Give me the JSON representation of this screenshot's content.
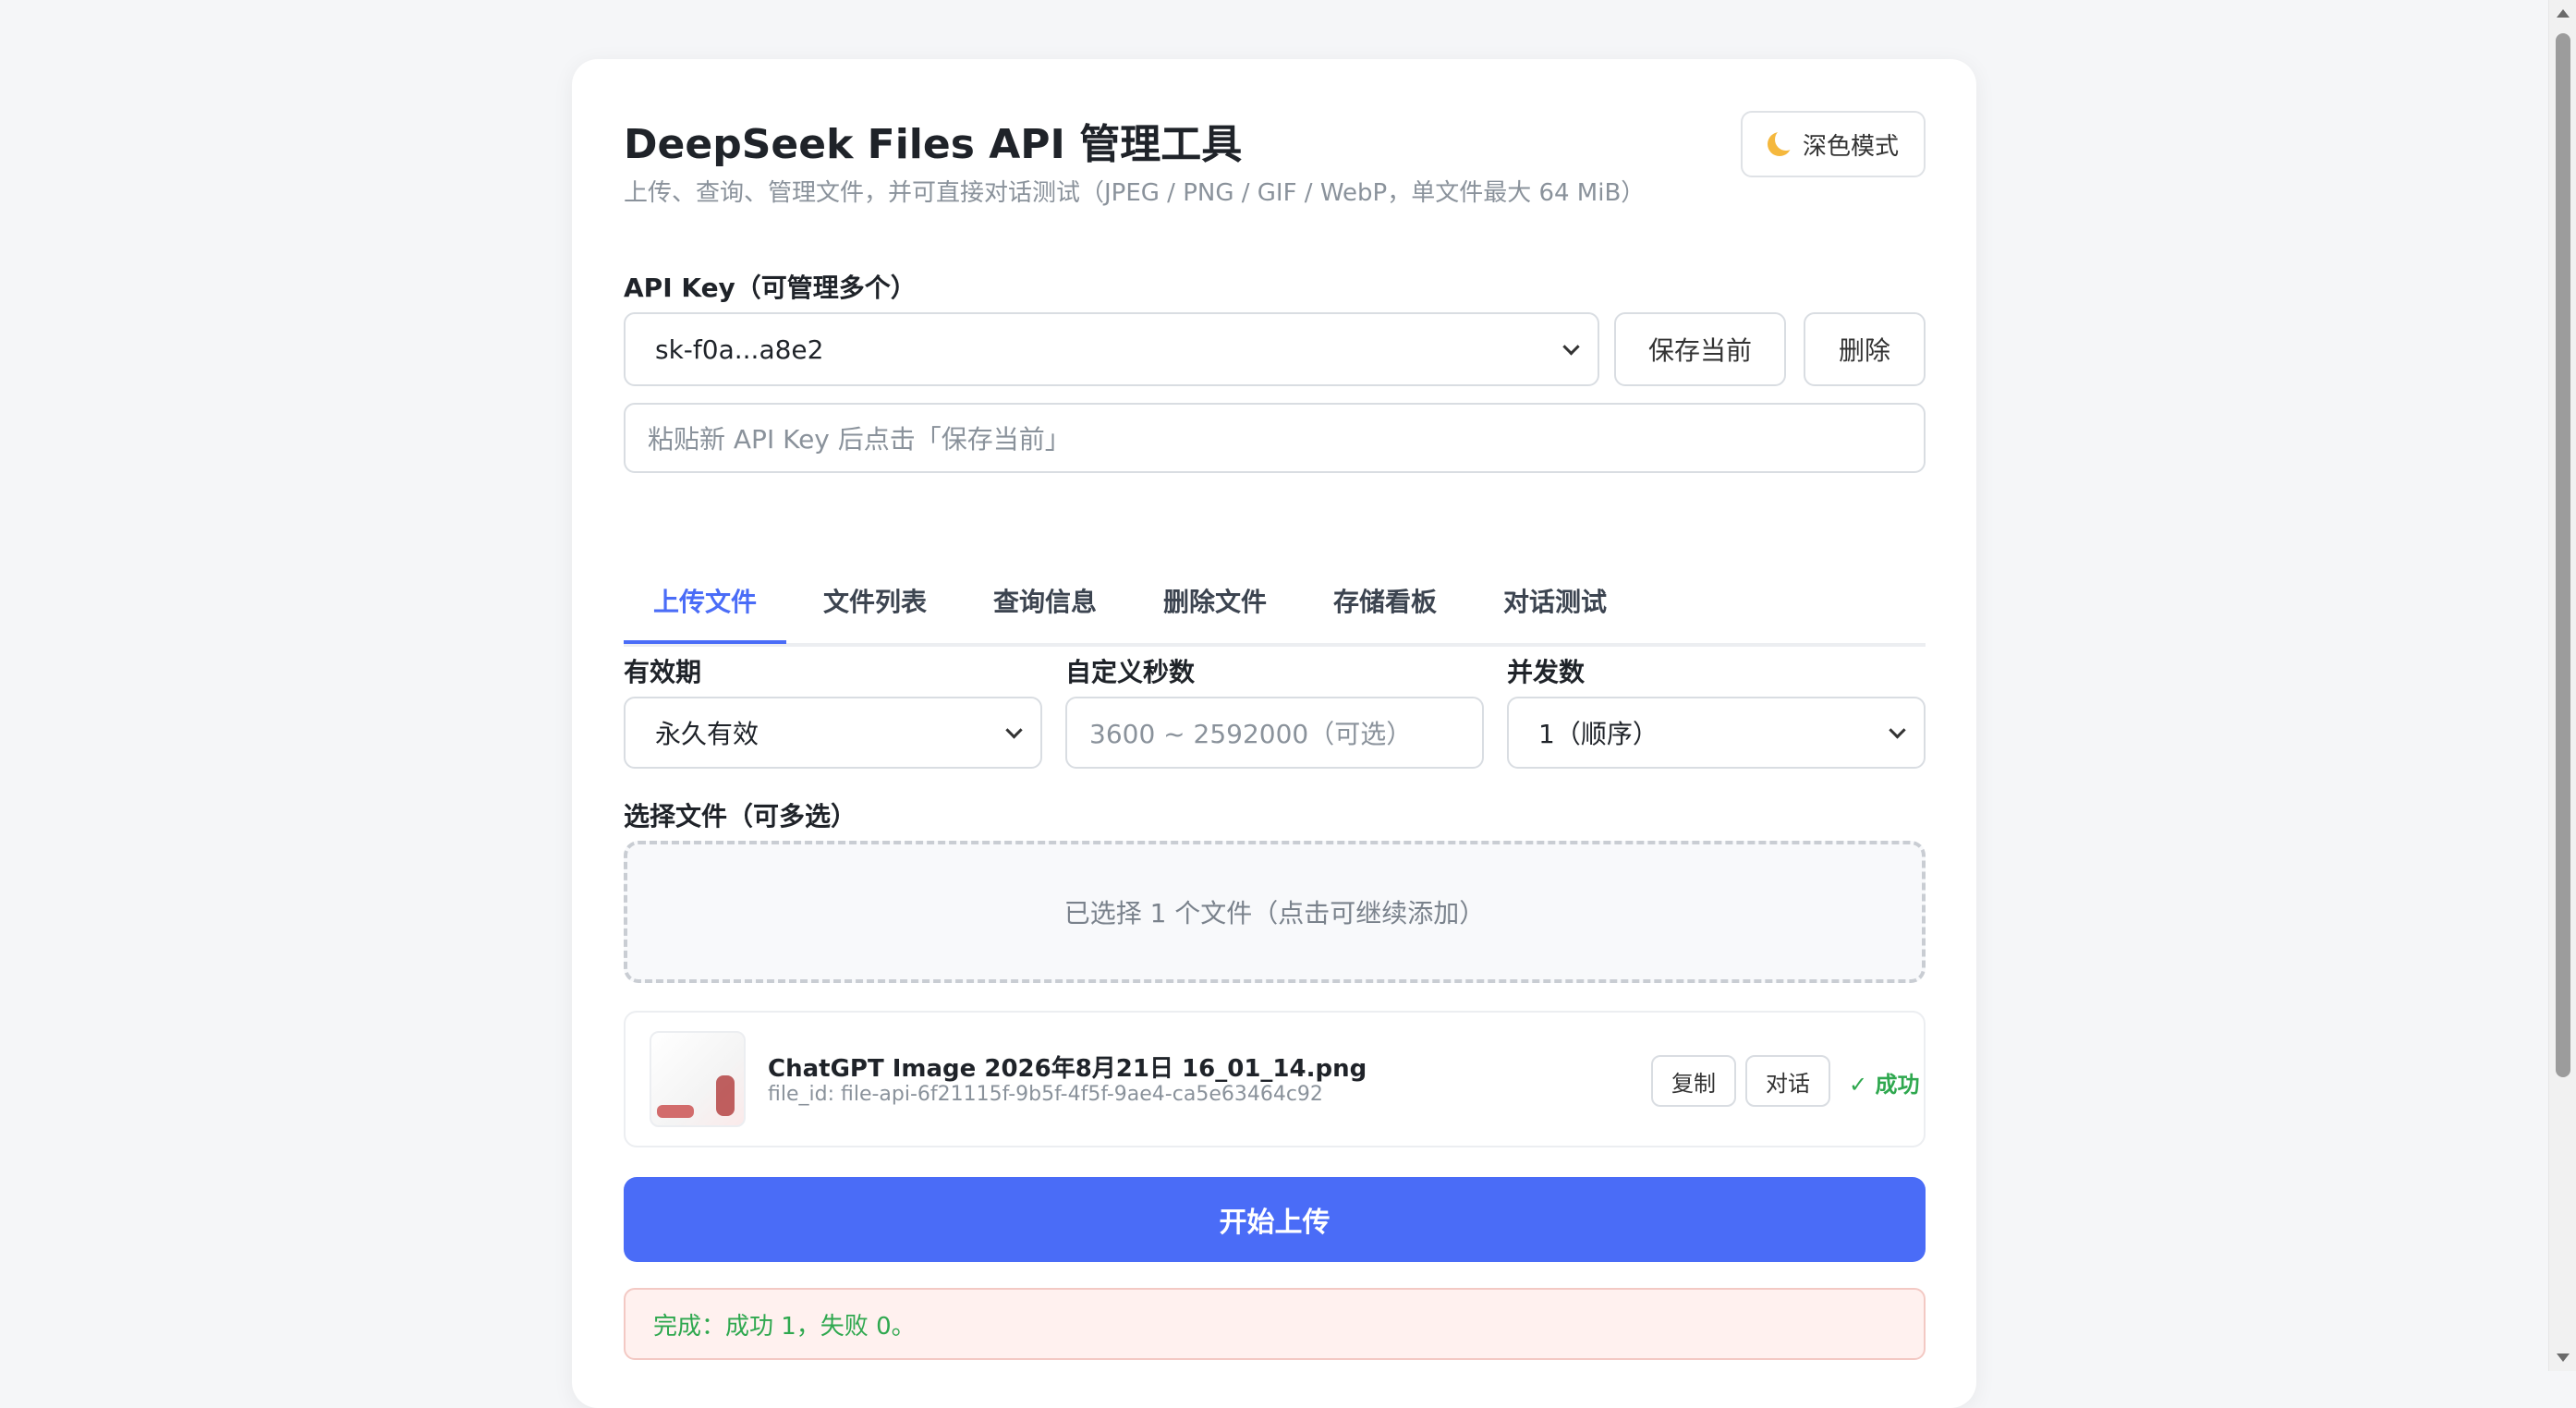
{
  "header": {
    "title": "DeepSeek Files API 管理工具",
    "subtitle": "上传、查询、管理文件，并可直接对话测试（JPEG / PNG / GIF / WebP，单文件最大 64 MiB）",
    "theme_button": "深色模式"
  },
  "api_key": {
    "label": "API Key（可管理多个）",
    "selected": "sk-f0a...a8e2",
    "save_button": "保存当前",
    "delete_button": "删除",
    "new_key_placeholder": "粘贴新 API Key 后点击「保存当前」"
  },
  "tabs": [
    {
      "label": "上传文件",
      "active": true
    },
    {
      "label": "文件列表",
      "active": false
    },
    {
      "label": "查询信息",
      "active": false
    },
    {
      "label": "删除文件",
      "active": false
    },
    {
      "label": "存储看板",
      "active": false
    },
    {
      "label": "对话测试",
      "active": false
    }
  ],
  "upload": {
    "expiry_label": "有效期",
    "expiry_value": "永久有效",
    "custom_seconds_label": "自定义秒数",
    "custom_seconds_placeholder": "3600 ~ 2592000（可选）",
    "concurrency_label": "并发数",
    "concurrency_value": "1（顺序）",
    "select_files_label": "选择文件（可多选）",
    "dropzone_text": "已选择 1 个文件（点击可继续添加）",
    "files": [
      {
        "name": "ChatGPT Image 2026年8月21日 16_01_14.png",
        "file_id": "file_id: file-api-6f21115f-9b5f-4f5f-9ae4-ca5e63464c92",
        "copy_label": "复制",
        "chat_label": "对话",
        "status": "✓ 成功"
      }
    ],
    "start_button": "开始上传",
    "result_text": "完成：成功 1，失败 0。"
  },
  "colors": {
    "accent": "#4a6cf7",
    "success": "#2fa84f",
    "status_bg": "#fff1ef"
  }
}
